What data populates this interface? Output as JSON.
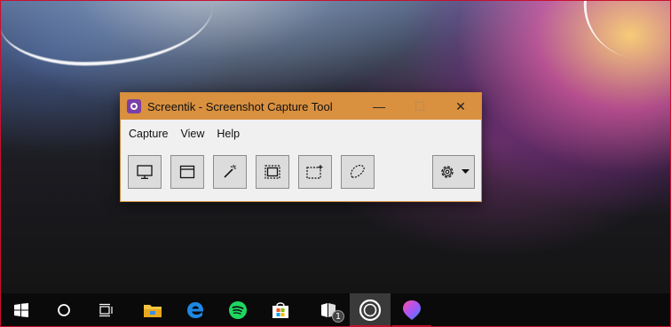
{
  "window": {
    "title": "Screentik - Screenshot Capture Tool",
    "controls": {
      "minimize": "—",
      "maximize": "☐",
      "close": "✕"
    }
  },
  "menu": {
    "items": [
      "Capture",
      "View",
      "Help"
    ]
  },
  "toolbar": {
    "tools": [
      {
        "name": "capture-fullscreen-button",
        "icon": "monitor-icon"
      },
      {
        "name": "capture-window-button",
        "icon": "window-icon"
      },
      {
        "name": "capture-magic-button",
        "icon": "magic-wand-icon"
      },
      {
        "name": "capture-object-button",
        "icon": "object-region-icon"
      },
      {
        "name": "capture-rectangle-button",
        "icon": "rectangle-region-icon"
      },
      {
        "name": "capture-freehand-button",
        "icon": "freehand-region-icon"
      }
    ],
    "settings": {
      "icon": "gear-icon",
      "dropdown": "caret-down-icon"
    }
  },
  "taskbar": {
    "items": [
      {
        "name": "start-button",
        "icon": "windows-logo-icon"
      },
      {
        "name": "search-button",
        "icon": "search-circle-icon"
      },
      {
        "name": "task-view-button",
        "icon": "task-view-icon"
      },
      {
        "name": "file-explorer-button",
        "icon": "folder-icon"
      },
      {
        "name": "edge-button",
        "icon": "edge-icon"
      },
      {
        "name": "spotify-button",
        "icon": "spotify-icon"
      },
      {
        "name": "store-button",
        "icon": "store-icon"
      },
      {
        "name": "notes-button",
        "icon": "notes-icon",
        "badge": "1"
      },
      {
        "name": "screentik-taskbar-button",
        "icon": "screentik-icon"
      },
      {
        "name": "paint3d-button",
        "icon": "paint3d-icon"
      }
    ]
  },
  "colors": {
    "titlebar": "#d9903f",
    "window_border": "#d08a3a",
    "taskbar": "#0a0a0a",
    "running_indicator": "#c8102e",
    "app_accent": "#7b3fa6"
  }
}
